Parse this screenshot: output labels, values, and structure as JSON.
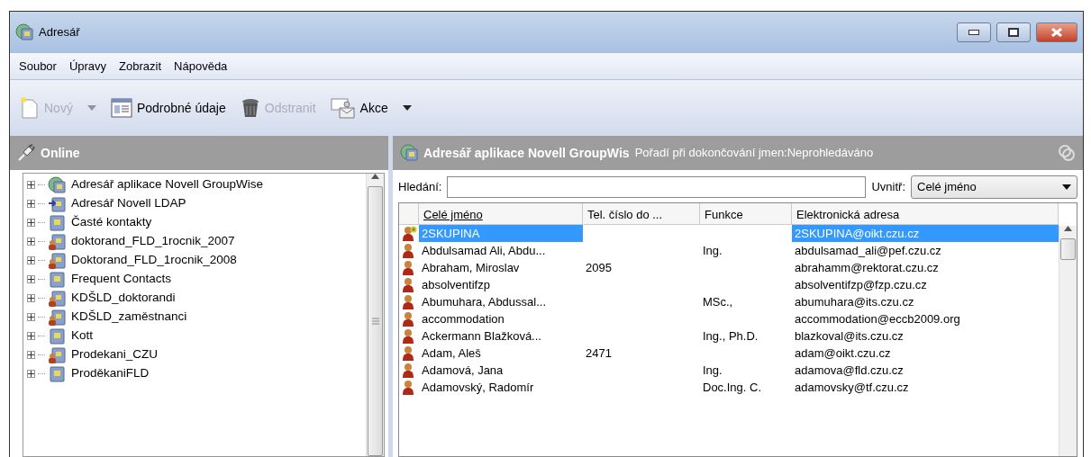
{
  "window": {
    "title": "Adresář"
  },
  "menu": [
    {
      "label": "Soubor"
    },
    {
      "label": "Úpravy"
    },
    {
      "label": "Zobrazit"
    },
    {
      "label": "Nápověda"
    }
  ],
  "toolbar": [
    {
      "label": "Nový",
      "kind": "new",
      "disabled": true,
      "dropdown": true
    },
    {
      "label": "Podrobné údaje",
      "kind": "details",
      "disabled": false,
      "dropdown": false
    },
    {
      "label": "Odstranit",
      "kind": "trash",
      "disabled": true,
      "dropdown": false
    },
    {
      "label": "Akce",
      "kind": "actions",
      "disabled": false,
      "dropdown": true
    }
  ],
  "left_pane": {
    "title": "Online",
    "tree": [
      {
        "label": "Adresář aplikace Novell GroupWise",
        "kind": "globe",
        "expanded": false
      },
      {
        "label": "Adresář Novell LDAP",
        "kind": "ldap",
        "expanded": false
      },
      {
        "label": "Časté kontakty",
        "kind": "book",
        "expanded": false
      },
      {
        "label": "doktorand_FLD_1rocnik_2007",
        "kind": "shared",
        "expanded": false
      },
      {
        "label": "Doktorand_FLD_1rocnik_2008",
        "kind": "shared",
        "expanded": false
      },
      {
        "label": "Frequent Contacts",
        "kind": "book",
        "expanded": false
      },
      {
        "label": "KDŠLD_doktorandi",
        "kind": "shared",
        "expanded": false
      },
      {
        "label": "KDŠLD_zaměstnanci",
        "kind": "shared",
        "expanded": false
      },
      {
        "label": "Kott",
        "kind": "book",
        "expanded": false
      },
      {
        "label": "Prodekani_CZU",
        "kind": "shared",
        "expanded": false
      },
      {
        "label": "ProděkaniFLD",
        "kind": "book",
        "expanded": false
      }
    ]
  },
  "right_pane": {
    "title": "Adresář aplikace Novell GroupWis",
    "status": "Pořadí při dokončování jmen:Neprohledáváno",
    "search": {
      "label": "Hledání:",
      "within_label": "Uvnitř:",
      "within_value": "Celé jméno"
    },
    "table": {
      "columns": [
        {
          "label": "Celé jméno",
          "sorted": true
        },
        {
          "label": "Tel. číslo do ...",
          "sorted": false
        },
        {
          "label": "Funkce",
          "sorted": false
        },
        {
          "label": "Elektronická adresa",
          "sorted": false
        }
      ],
      "rows": [
        {
          "kind": "group",
          "selected": true,
          "cells": [
            "2SKUPINA",
            "",
            "",
            "2SKUPINA@oikt.czu.cz"
          ]
        },
        {
          "kind": "person",
          "selected": false,
          "cells": [
            "Abdulsamad Ali, Abdu...",
            "",
            "Ing.",
            "abdulsamad_ali@pef.czu.cz"
          ]
        },
        {
          "kind": "person",
          "selected": false,
          "cells": [
            "Abraham, Miroslav",
            "2095",
            "",
            "abrahamm@rektorat.czu.cz"
          ]
        },
        {
          "kind": "person",
          "selected": false,
          "cells": [
            "absolventifzp",
            "",
            "",
            "absolventifzp@fzp.czu.cz"
          ]
        },
        {
          "kind": "person",
          "selected": false,
          "cells": [
            "Abumuhara, Abdussal...",
            "",
            "MSc.,",
            "abumuhara@its.czu.cz"
          ]
        },
        {
          "kind": "person",
          "selected": false,
          "cells": [
            "accommodation",
            "",
            "",
            "accommodation@eccb2009.org"
          ]
        },
        {
          "kind": "person",
          "selected": false,
          "cells": [
            "Ackermann Blažková...",
            "",
            "Ing., Ph.D.",
            "blazkoval@its.czu.cz"
          ]
        },
        {
          "kind": "person",
          "selected": false,
          "cells": [
            "Adam, Aleš",
            "2471",
            "",
            "adam@oikt.czu.cz"
          ]
        },
        {
          "kind": "person",
          "selected": false,
          "cells": [
            "Adamová, Jana",
            "",
            "Ing.",
            "adamova@fld.czu.cz"
          ]
        },
        {
          "kind": "person",
          "selected": false,
          "cells": [
            "Adamovský, Radomír",
            "",
            "Doc.Ing. C.",
            "adamovsky@tf.czu.cz"
          ]
        }
      ]
    }
  }
}
